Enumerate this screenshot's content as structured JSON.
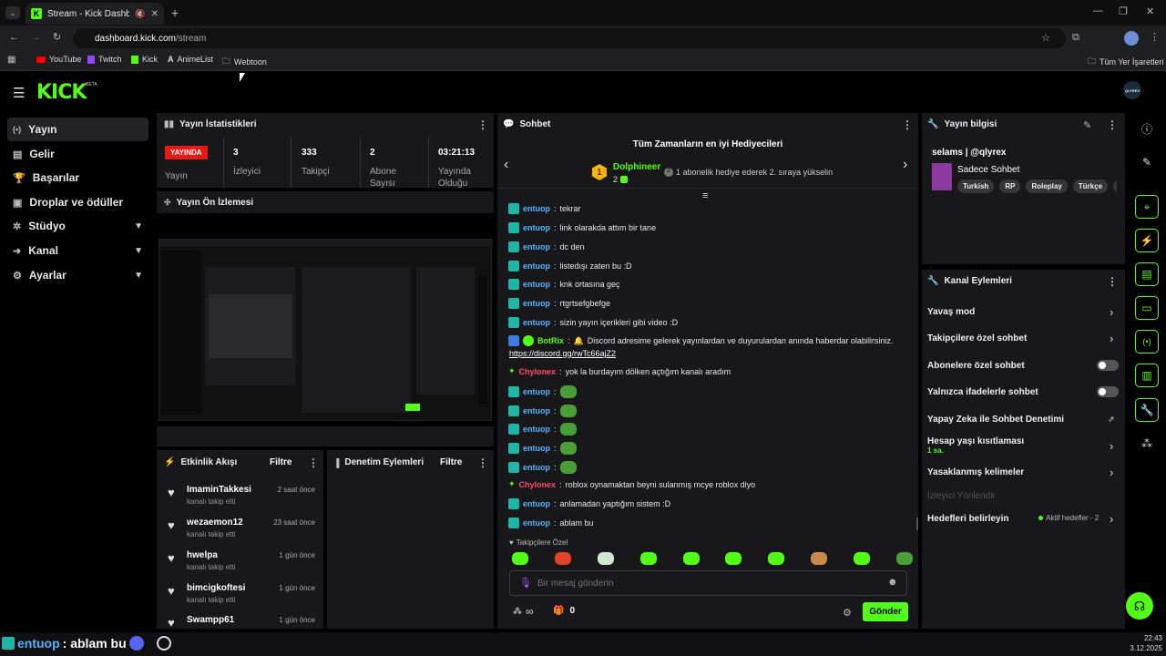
{
  "browser": {
    "tab_title": "Stream - Kick Dashboard",
    "url_host": "dashboard.kick.com",
    "url_path": "/stream",
    "bookmarks": [
      "YouTube",
      "Twitch",
      "Kick",
      "AnimeList",
      "Webtoon"
    ],
    "all_bookmarks": "Tüm Yer İşaretleri"
  },
  "app": {
    "logo": "KICK",
    "logo_badge": "BETA",
    "avatar_label": "QLYREX",
    "accent": "#53fc18"
  },
  "sidebar": {
    "items": [
      {
        "label": "Yayın",
        "icon": "broadcast-icon"
      },
      {
        "label": "Gelir",
        "icon": "money-icon"
      },
      {
        "label": "Başarılar",
        "icon": "trophy-icon"
      },
      {
        "label": "Droplar ve ödüller",
        "icon": "gift-icon"
      },
      {
        "label": "Stüdyo",
        "icon": "studio-icon"
      },
      {
        "label": "Kanal",
        "icon": "channel-icon"
      },
      {
        "label": "Ayarlar",
        "icon": "gear-icon"
      }
    ]
  },
  "stats": {
    "title": "Yayın İstatistikleri",
    "live_badge": "YAYINDA",
    "live_label": "Yayın",
    "viewers": {
      "value": "3",
      "label": "İzleyici"
    },
    "followers": {
      "value": "333",
      "label": "Takipçi"
    },
    "subs": {
      "value": "2",
      "label": "Abone Sayısı"
    },
    "duration": {
      "value": "03:21:13",
      "label": "Yayında Olduğu"
    }
  },
  "preview": {
    "title": "Yayın Ön İzlemesi"
  },
  "activity": {
    "title": "Etkinlik Akışı",
    "filter": "Filtre",
    "items": [
      {
        "name": "ImaminTakkesi",
        "sub": "kanalı takip etti",
        "time": "2 saat önce"
      },
      {
        "name": "wezaemon12",
        "sub": "kanalı takip etti",
        "time": "23 saat önce"
      },
      {
        "name": "hwelpa",
        "sub": "kanalı takip etti",
        "time": "1 gün önce"
      },
      {
        "name": "bimcigkoftesi",
        "sub": "kanalı takip etti",
        "time": "1 gün önce"
      },
      {
        "name": "Swampp61",
        "sub": "",
        "time": "1 gün önce"
      }
    ]
  },
  "moderation": {
    "title": "Denetim Eylemleri",
    "filter": "Filtre"
  },
  "chat": {
    "title": "Sohbet",
    "gifters_title": "Tüm Zamanların en iyi Hediyecileri",
    "top_gifter": "Dolphineer",
    "top_gifter_count": "2",
    "gifter_hint": "1 abonelik hediye ederek 2. sıraya yükselin",
    "messages": [
      {
        "user": "entuop",
        "text": "tekrar"
      },
      {
        "user": "entuop",
        "text": "link olarakda attım bir tane"
      },
      {
        "user": "entuop",
        "text": "dc den"
      },
      {
        "user": "entuop",
        "text": "listedışı zaten bu :D"
      },
      {
        "user": "entuop",
        "text": "knk ortasına geç"
      },
      {
        "user": "entuop",
        "text": "rtgrtsefgbefge"
      },
      {
        "user": "entuop",
        "text": "sizin yayın içerikleri gibi video :D"
      }
    ],
    "bot_user": "BotRix",
    "bot_text": "Discord adresime gelerek yayınlardan ve duyurulardan anında haberdar olabilirsiniz.",
    "bot_link": "https://discord.gg/rwTc66ajZ2",
    "msg2": [
      {
        "user": "Chylonex",
        "text": "yok la burdayım dölken açtığım kanalı aradım"
      },
      {
        "user": "entuop",
        "text": ""
      },
      {
        "user": "entuop",
        "text": ""
      },
      {
        "user": "entuop",
        "text": ""
      },
      {
        "user": "entuop",
        "text": ""
      },
      {
        "user": "entuop",
        "text": ""
      },
      {
        "user": "Chylonex",
        "text": "roblox oynamaktan beyni sulanmış mcye roblox diyo"
      },
      {
        "user": "entuop",
        "text": "anlamadan yaptığım sistem :D"
      },
      {
        "user": "entuop",
        "text": "ablam bu"
      }
    ],
    "followers_only": "Takipçilere Özel",
    "placeholder": "Bir mesaj gönderin",
    "infinity": "∞",
    "gift_count": "0",
    "send": "Gönder"
  },
  "stream_info": {
    "title": "Yayın bilgisi",
    "stream_title": "selams | @qlyrex",
    "category": "Sadece Sohbet",
    "tags": [
      "Turkish",
      "RP",
      "Roleplay",
      "Türkçe",
      "c"
    ]
  },
  "channel_actions": {
    "title": "Kanal Eylemleri",
    "slow_mode": "Yavaş mod",
    "followers_chat": "Takipçilere özel sohbet",
    "subs_chat": "Abonelere özel sohbet",
    "emote_chat": "Yalnızca ifadelerle sohbet",
    "ai_mod": "Yapay Zeka ile Sohbet Denetimi",
    "age_limit": "Hesap yaşı kısıtlaması",
    "age_value": "1 sa.",
    "banned_words": "Yasaklanmış kelimeler",
    "viewer_redirect": "İzleyici Yönlendir",
    "goals": "Hedefleri belirleyin",
    "goals_status": "Aktif hedefler - 2"
  },
  "overlay": {
    "user": "entuop",
    "text": ": ablam bu"
  },
  "clock": {
    "time": "22:43",
    "date": "3.12.2025"
  }
}
